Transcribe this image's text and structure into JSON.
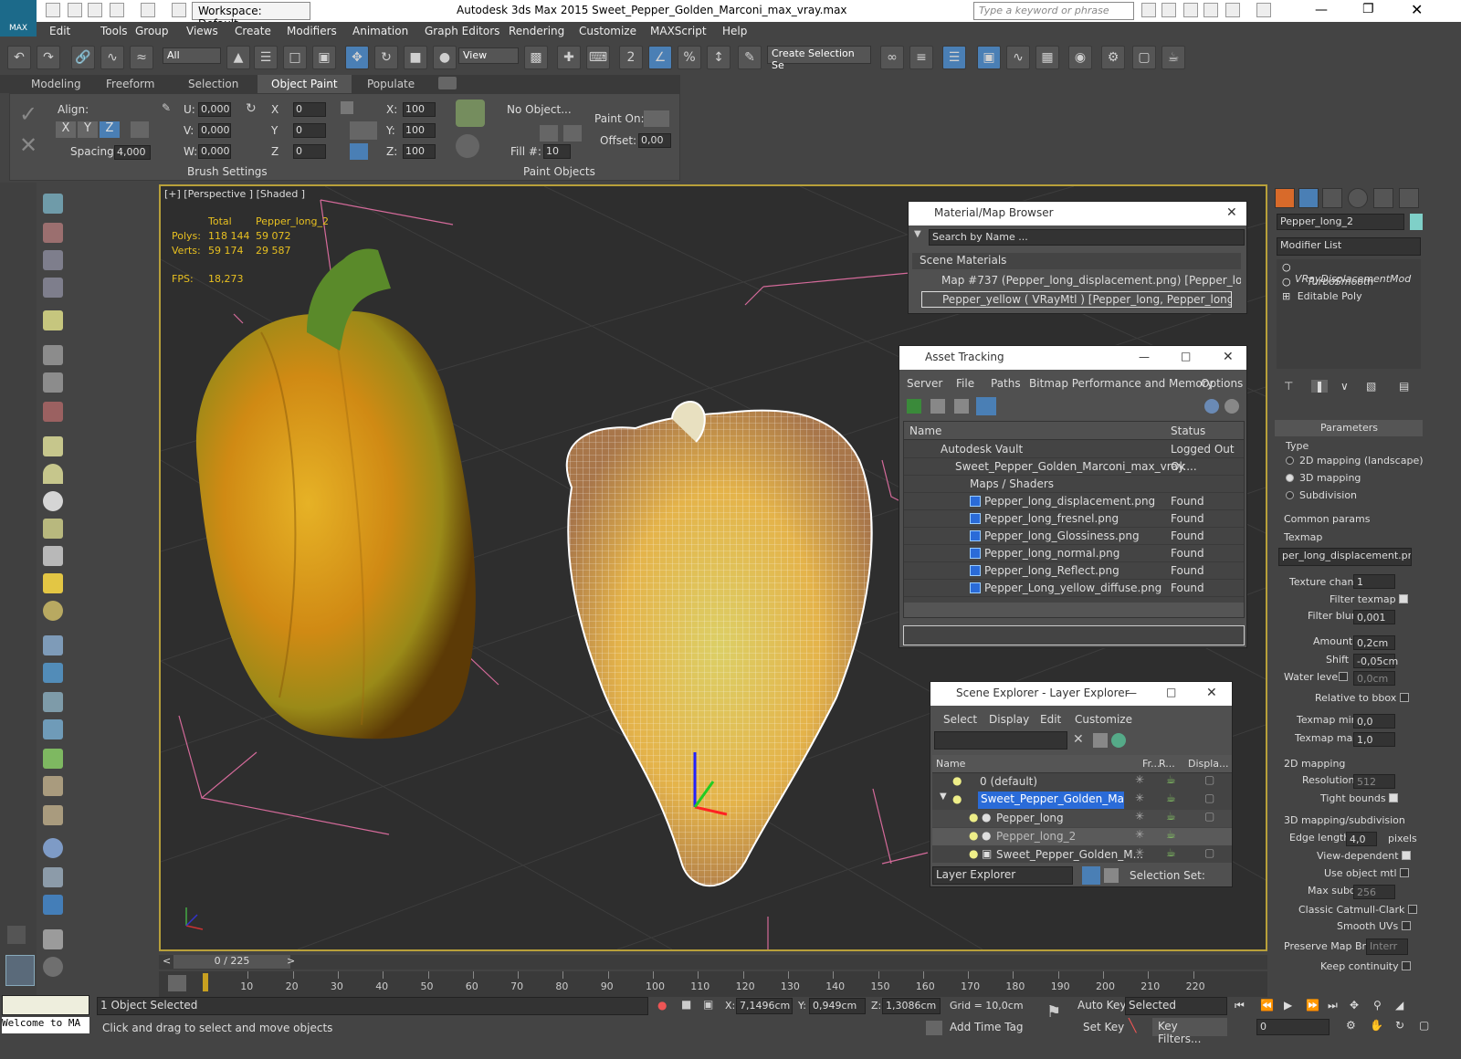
{
  "app": {
    "logo_label": "MAX",
    "title": "Autodesk 3ds Max  2015    Sweet_Pepper_Golden_Marconi_max_vray.max",
    "workspace": "Workspace: Default",
    "search_placeholder": "Type a keyword or phrase"
  },
  "menus": [
    "Edit",
    "Tools",
    "Group",
    "Views",
    "Create",
    "Modifiers",
    "Animation",
    "Graph Editors",
    "Rendering",
    "Customize",
    "MAXScript",
    "Help"
  ],
  "toolbar": {
    "filter": "All",
    "ref_coord": "View",
    "selection_set": "Create Selection Se"
  },
  "ribbon": {
    "tabs": [
      "Modeling",
      "Freeform",
      "Selection",
      "Object Paint",
      "Populate"
    ],
    "active_tab": "Object Paint",
    "align_label": "Align:",
    "spacing_label": "Spacing:",
    "spacing_value": "4,000",
    "u": "0,000",
    "v": "0,000",
    "w": "0,000",
    "x": "0",
    "y": "0",
    "z": "0",
    "sx": "100",
    "sy": "100",
    "sz": "100",
    "paint_on_label": "Paint On:",
    "offset_label": "Offset:",
    "offset_value": "0,00",
    "no_object": "No Object...",
    "fill_label": "Fill #:",
    "fill_value": "10",
    "brush_settings": "Brush Settings",
    "paint_objects": "Paint Objects",
    "u_label": "U:",
    "v_label": "V:",
    "w_label": "W:",
    "x_label": "X:",
    "y_label": "Y:",
    "z_label": "Z:",
    "axis_x": "X",
    "axis_y": "Y",
    "axis_z": "Z",
    "rot_x": "X",
    "rot_y": "Y",
    "rot_z": "Z"
  },
  "viewport": {
    "label": "[+] [Perspective ] [Shaded ]",
    "stats": {
      "col_total": "Total",
      "col_obj": "Pepper_long_2",
      "polys_label": "Polys:",
      "polys_total": "118 144",
      "polys_obj": "59 072",
      "verts_label": "Verts:",
      "verts_total": "59 174",
      "verts_obj": "29 587",
      "fps_label": "FPS:",
      "fps": "18,273"
    }
  },
  "material_browser": {
    "title": "Material/Map Browser",
    "search_placeholder": "Search by Name ...",
    "section": "Scene Materials",
    "items": [
      "Map #737 (Pepper_long_displacement.png) [Pepper_long, P...",
      "Pepper_yellow ( VRayMtl ) [Pepper_long, Pepper_long_2]"
    ]
  },
  "asset_tracking": {
    "title": "Asset Tracking",
    "menus": [
      "Server",
      "File",
      "Paths",
      "Bitmap Performance and Memory",
      "Options"
    ],
    "columns": [
      "Name",
      "Status"
    ],
    "rows": [
      {
        "name": "Autodesk Vault",
        "status": "Logged Out ..."
      },
      {
        "name": "Sweet_Pepper_Golden_Marconi_max_vray....",
        "status": "Ok"
      },
      {
        "name": "Maps / Shaders",
        "status": ""
      },
      {
        "name": "Pepper_long_displacement.png",
        "status": "Found"
      },
      {
        "name": "Pepper_long_fresnel.png",
        "status": "Found"
      },
      {
        "name": "Pepper_long_Glossiness.png",
        "status": "Found"
      },
      {
        "name": "Pepper_long_normal.png",
        "status": "Found"
      },
      {
        "name": "Pepper_long_Reflect.png",
        "status": "Found"
      },
      {
        "name": "Pepper_Long_yellow_diffuse.png",
        "status": "Found"
      }
    ]
  },
  "scene_explorer": {
    "title": "Scene Explorer - Layer Explorer",
    "menus": [
      "Select",
      "Display",
      "Edit",
      "Customize"
    ],
    "columns": [
      "Name",
      "Fr...",
      "R...",
      "Displa..."
    ],
    "rows": [
      "0 (default)",
      "Sweet_Pepper_Golden_Marconi",
      "Pepper_long",
      "Pepper_long_2",
      "Sweet_Pepper_Golden_M..."
    ],
    "footer_dropdown": "Layer Explorer",
    "selection_set": "Selection Set:"
  },
  "command_panel": {
    "object_name": "Pepper_long_2",
    "modifier_list": "Modifier List",
    "stack": [
      "VRayDisplacementMod",
      "TurboSmooth",
      "Editable Poly"
    ],
    "parameters": "Parameters",
    "type_label": "Type",
    "types": [
      "2D mapping (landscape)",
      "3D mapping",
      "Subdivision"
    ],
    "common": "Common params",
    "texmap_label": "Texmap",
    "texmap": "per_long_displacement.png)",
    "texture_chan_label": "Texture chan",
    "texture_chan": "1",
    "filter_texmap": "Filter texmap",
    "filter_blur_label": "Filter blur",
    "filter_blur": "0,001",
    "amount_label": "Amount",
    "amount": "0,2cm",
    "shift_label": "Shift",
    "shift": "-0,05cm",
    "water_label": "Water level",
    "water": "0,0cm",
    "relative": "Relative to bbox",
    "tmin_label": "Texmap min",
    "tmin": "0,0",
    "tmax_label": "Texmap max",
    "tmax": "1,0",
    "map2d": "2D mapping",
    "resolution_label": "Resolution",
    "resolution": "512",
    "tight": "Tight bounds",
    "map3d": "3D mapping/subdivision",
    "edge_label": "Edge length",
    "edge": "4,0",
    "pixels": "pixels",
    "view_dep": "View-dependent",
    "use_obj": "Use object mtl",
    "max_subdivs_label": "Max subdivs",
    "max_subdivs": "256",
    "catmull": "Classic Catmull-Clark",
    "smooth_uvs": "Smooth UVs",
    "preserve_label": "Preserve Map Bnd",
    "preserve": "Interr",
    "keep": "Keep continuity"
  },
  "timeline": {
    "frame": "0 / 225",
    "ticks": [
      "10",
      "20",
      "30",
      "40",
      "50",
      "60",
      "70",
      "80",
      "90",
      "100",
      "110",
      "120",
      "130",
      "140",
      "150",
      "160",
      "170",
      "180",
      "190",
      "200",
      "210",
      "220"
    ]
  },
  "status": {
    "maxscript": "Welcome to MA",
    "selected": "1 Object Selected",
    "hint": "Click and drag to select and move objects",
    "x_label": "X:",
    "x": "7,1496cm",
    "y_label": "Y:",
    "y": "0,949cm",
    "z_label": "Z:",
    "z": "1,3086cm",
    "grid": "Grid = 10,0cm",
    "auto_key": "Auto Key",
    "set_key": "Set Key",
    "key_mode": "Selected",
    "key_filters": "Key Filters...",
    "add_time_tag": "Add Time Tag",
    "frame_field": "0"
  },
  "colors": {
    "accent": "#4a7fb5",
    "viewport_border": "#b8a03a",
    "stats": "#e8c020"
  }
}
